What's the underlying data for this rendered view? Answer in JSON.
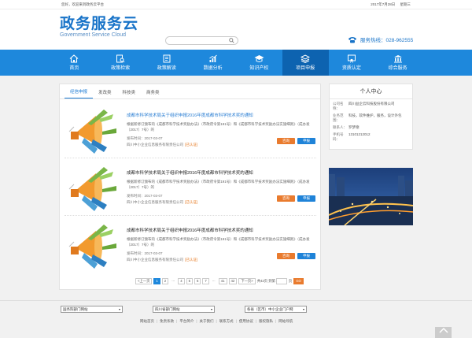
{
  "topbar": {
    "greeting": "您好，欢迎来到政务云平台",
    "date": "2017年7月28日",
    "weekday": "星期三"
  },
  "header": {
    "logo_cn": "政务服务云",
    "logo_en": "Government Service Cloud",
    "search_placeholder": "",
    "hotline": "服务热线：028-962555"
  },
  "nav": {
    "items": [
      {
        "label": "首页",
        "icon": "home-icon"
      },
      {
        "label": "政策检索",
        "icon": "policy-search-icon"
      },
      {
        "label": "政策解读",
        "icon": "policy-read-icon"
      },
      {
        "label": "数据分析",
        "icon": "chart-icon"
      },
      {
        "label": "知识产权",
        "icon": "graduation-cap-icon"
      },
      {
        "label": "项目申报",
        "icon": "layers-icon",
        "active": true
      },
      {
        "label": "资质认定",
        "icon": "certificate-icon"
      },
      {
        "label": "综合服务",
        "icon": "building-icon"
      }
    ]
  },
  "tabs": [
    "经信申报",
    "发改类",
    "科技类",
    "商务类"
  ],
  "items": [
    {
      "title": "成都市科学技术局关于组织申报2016年度成都市科学技术奖的通知",
      "desc": "根据新修订颁布的《成都市科学技术奖励办法》（市政府令第191号）和《成都市科学技术奖励办法实施细则》（成办发〔2017〕7号）的",
      "date": "发布时间：2017-03-07",
      "org": "四川中小企业信息服务有限责任公司",
      "badge": "[已认证]",
      "consult": "咨询",
      "apply": "申报"
    },
    {
      "title": "成都市科学技术局关于组织申报2016年度成都市科学技术奖的通知",
      "desc": "根据新修订颁布的《成都市科学技术奖励办法》（市政府令第191号）和《成都市科学技术奖励办法实施细则》（成办发〔2017〕7号）的",
      "date": "发布时间：2017-03-07",
      "org": "四川中小企业信息服务有限责任公司",
      "badge": "[已认证]",
      "consult": "咨询",
      "apply": "申报"
    },
    {
      "title": "成都市科学技术局关于组织申报2016年度成都市科学技术奖的通知",
      "desc": "根据新修订颁布的《成都市科学技术奖励办法》（市政府令第191号）和《成都市科学技术奖励办法实施细则》（成办发〔2017〕7号）的",
      "date": "发布时间：2017-03-07",
      "org": "四川中小企业信息服务有限责任公司",
      "badge": "[已认证]",
      "consult": "咨询",
      "apply": "申报"
    }
  ],
  "pager": {
    "prev": "<上一页",
    "pages": [
      "1",
      "2",
      "...",
      "4",
      "5",
      "6",
      "7",
      "...",
      "41",
      "42"
    ],
    "next": "下一页>",
    "total": "共42页 到第",
    "page_unit": "页",
    "go": "GO"
  },
  "user": {
    "heading": "个人中心",
    "rows": [
      {
        "k": "公司名称：",
        "v": "四川益企云科技股份有限公司"
      },
      {
        "k": "业务范围：",
        "v": "科技，软件维护，服务，设计外包"
      },
      {
        "k": "联系人：",
        "v": "罗梦德"
      },
      {
        "k": "手机号码：",
        "v": "13101212012"
      }
    ]
  },
  "footer": {
    "selects": [
      "国务院部门网站",
      "四川省部门网站",
      "各省（区市）中小企业门户网"
    ],
    "links": [
      "网站首页",
      "免责条款",
      "平台简介",
      "关于我们",
      "联系方式",
      "使用协议",
      "版权隐私",
      "网站导航"
    ]
  },
  "colors": {
    "primary": "#1e88dc",
    "nav_active": "#0d63b0",
    "consult": "#e97b2e",
    "apply": "#1f83d8"
  }
}
